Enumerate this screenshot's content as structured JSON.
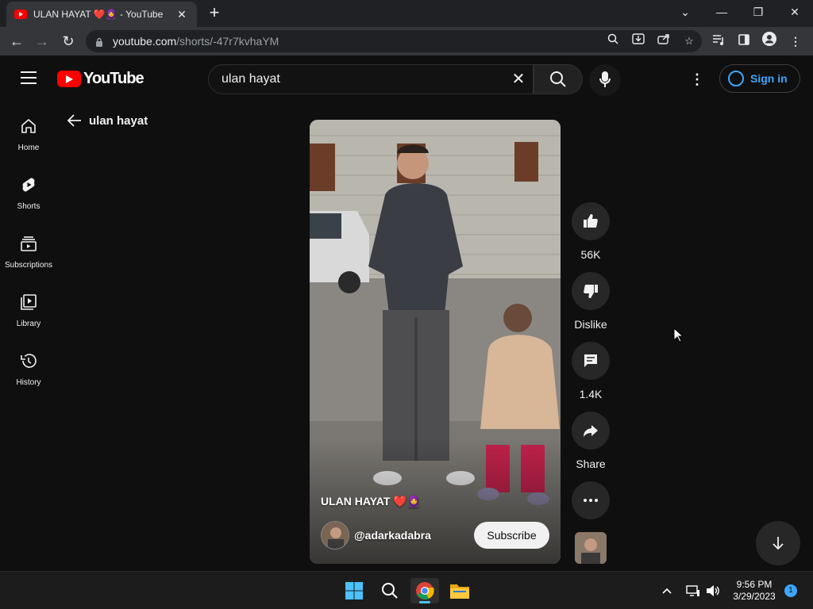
{
  "browser": {
    "tab_title": "ULAN HAYAT ❤️🧕 - YouTube",
    "url_host": "youtube.com",
    "url_path": "/shorts/-47r7kvhaYM"
  },
  "header": {
    "logo_text": "YouTube",
    "search_value": "ulan hayat",
    "sign_in_label": "Sign in"
  },
  "sidebar": {
    "items": [
      {
        "label": "Home"
      },
      {
        "label": "Shorts"
      },
      {
        "label": "Subscriptions"
      },
      {
        "label": "Library"
      },
      {
        "label": "History"
      }
    ]
  },
  "search_back": {
    "label": "ulan hayat"
  },
  "short": {
    "title": "ULAN HAYAT ❤️🧕",
    "channel": "@adarkadabra",
    "subscribe_label": "Subscribe"
  },
  "actions": {
    "like_count": "56K",
    "dislike_label": "Dislike",
    "comment_count": "1.4K",
    "share_label": "Share"
  },
  "taskbar": {
    "time": "9:56 PM",
    "date": "3/29/2023",
    "notifications": "1"
  },
  "colors": {
    "accent": "#3ea6ff",
    "brand": "#ff0000",
    "background": "#0f0f0f"
  }
}
